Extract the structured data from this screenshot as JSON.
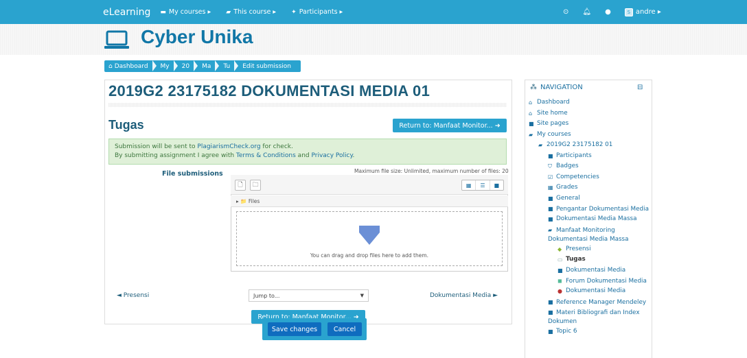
{
  "navbar": {
    "brand": "eLearning",
    "items": [
      {
        "label": "My courses ▸",
        "icon": "monitor-icon"
      },
      {
        "label": "This course ▸",
        "icon": "book-icon"
      },
      {
        "label": "Participants ▸",
        "icon": "users-icon"
      }
    ],
    "user": "andre ▸",
    "user_initial": "S"
  },
  "site_title": "Cyber Unika",
  "breadcrumb": [
    "Dashboard",
    "My",
    "20",
    "Ma",
    "Tu",
    "Edit submission"
  ],
  "course_title": "2019G2 23175182 DOKUMENTASI MEDIA 01",
  "page_heading": "Tugas",
  "return_button": "Return to: Manfaat Monitor... ➜",
  "notice": {
    "line1_prefix": "Submission will be sent to ",
    "line1_link": "PlagiarismCheck.org",
    "line1_suffix": " for check.",
    "line2_prefix": "By submitting assignment I agree with ",
    "line2_link1": "Terms & Conditions",
    "line2_mid": " and ",
    "line2_link2": "Privacy Policy",
    "line2_suffix": "."
  },
  "file_submissions": {
    "label": "File submissions",
    "max_size": "Maximum file size: Unlimited, maximum number of files: 20",
    "path": "▸ 📁 Files",
    "drop_text": "You can drag and drop files here to add them."
  },
  "activity_nav": {
    "prev": "◄ Presensi",
    "jump": "Jump to...",
    "next": "Dokumentasi Media ►"
  },
  "actions": {
    "save": "Save changes",
    "cancel": "Cancel"
  },
  "navigation": {
    "title": "NAVIGATION",
    "collapse": "⊟",
    "items": [
      {
        "label": "Dashboard",
        "icon": "home-icon",
        "indent": 0
      },
      {
        "label": "Site home",
        "icon": "home-icon",
        "indent": 0
      },
      {
        "label": "Site pages",
        "icon": "folder-icon",
        "indent": 0
      },
      {
        "label": "My courses",
        "icon": "folder-open-icon",
        "indent": 0
      },
      {
        "label": "2019G2 23175182 01",
        "icon": "folder-open-icon",
        "indent": 1
      },
      {
        "label": "Participants",
        "icon": "folder-icon",
        "indent": 2
      },
      {
        "label": "Badges",
        "icon": "shield-icon",
        "indent": 2
      },
      {
        "label": "Competencies",
        "icon": "check-square-icon",
        "indent": 2
      },
      {
        "label": "Grades",
        "icon": "table-icon",
        "indent": 2
      },
      {
        "label": "General",
        "icon": "folder-icon",
        "indent": 2
      },
      {
        "label": "Pengantar Dokumentasi Media",
        "icon": "folder-icon",
        "indent": 2
      },
      {
        "label": "Dokumentasi Media Massa",
        "icon": "folder-icon",
        "indent": 2
      },
      {
        "label": "Manfaat Monitoring Dokumentasi Media Massa",
        "icon": "folder-open-icon",
        "indent": 2
      },
      {
        "label": "Presensi",
        "icon": "attendance-icon",
        "indent": 3
      },
      {
        "label": "Tugas",
        "icon": "assignment-icon",
        "indent": 3,
        "current": true
      },
      {
        "label": "Dokumentasi Media",
        "icon": "folder-quiz-icon",
        "indent": 3
      },
      {
        "label": "Forum Dokumentasi Media",
        "icon": "forum-icon",
        "indent": 3
      },
      {
        "label": "Dokumentasi Media",
        "icon": "plagiarism-icon",
        "indent": 3
      },
      {
        "label": "Reference Manager Mendeley",
        "icon": "folder-icon",
        "indent": 2
      },
      {
        "label": "Materi Bibliografi dan Index Dokumen",
        "icon": "folder-icon",
        "indent": 2
      },
      {
        "label": "Topic 6",
        "icon": "folder-icon",
        "indent": 2
      }
    ]
  }
}
